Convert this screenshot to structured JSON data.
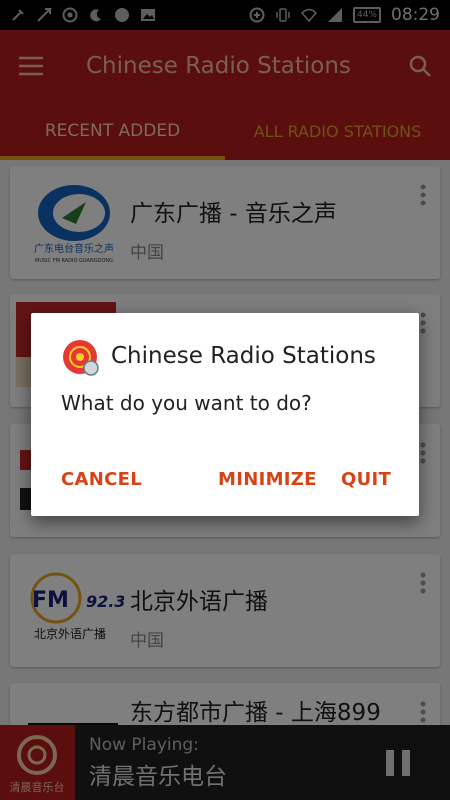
{
  "status_bar": {
    "time": "08:29",
    "battery": "44%"
  },
  "app": {
    "title": "Chinese Radio Stations",
    "tabs": [
      {
        "label": "RECENT ADDED",
        "active": true
      },
      {
        "label": "ALL RADIO STATIONS",
        "active": false
      }
    ]
  },
  "stations": [
    {
      "name": "广东广播 - 音乐之声",
      "subtitle": "中国",
      "logo_text": "广东电台音乐之声",
      "logo_sub": "MUSIC FM RADIO GUANGDONG"
    },
    {
      "name": "",
      "subtitle": ""
    },
    {
      "name": "",
      "subtitle": ""
    },
    {
      "name": "北京外语广播",
      "subtitle": "中国",
      "logo_text": "北京外语广播",
      "logo_freq": "FM92.3"
    },
    {
      "name": "东方都市广播 - 上海899",
      "subtitle": ""
    }
  ],
  "dialog": {
    "title": "Chinese Radio Stations",
    "message": "What do you want to do?",
    "buttons": {
      "cancel": "CANCEL",
      "minimize": "MINIMIZE",
      "quit": "QUIT"
    }
  },
  "player": {
    "label": "Now Playing:",
    "title": "清晨音乐电台",
    "art_text": "清晨音乐台"
  },
  "colors": {
    "primary": "#b71c1c",
    "tab_indicator": "#e6a525",
    "dialog_button": "#d84315"
  }
}
